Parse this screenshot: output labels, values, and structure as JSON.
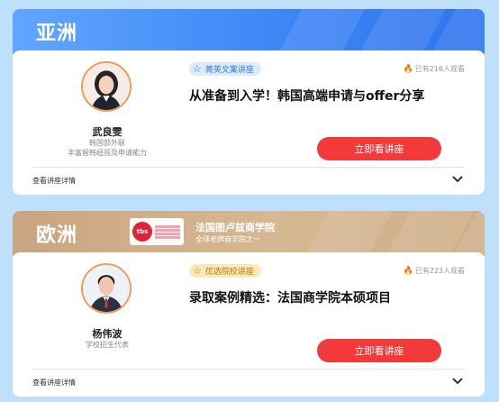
{
  "asia": {
    "region_title": "亚洲",
    "speaker": {
      "name": "武良雯",
      "line1": "韩国部外联",
      "line2": "丰富留韩经验及申请能力"
    },
    "tag": "菁英文案讲座",
    "views": "已有216人观看",
    "title": "从准备到入学！韩国高端申请与offer分享",
    "button": "立即看讲座",
    "details": "查看讲座详情"
  },
  "europe": {
    "region_title": "欧洲",
    "school": {
      "logo_text": "tbs",
      "name": "法国图卢兹商学院",
      "subtitle": "全球老牌商学院之一"
    },
    "speaker": {
      "name": "杨伟波",
      "line1": "学校招生代表"
    },
    "tag": "优选院校讲座",
    "views": "已有223人观看",
    "title": "录取案例精选：法国商学院本硕项目",
    "button": "立即看讲座",
    "details": "查看讲座详情"
  },
  "colors": {
    "accent_blue": "#2f74ee",
    "accent_gold": "#d6b893",
    "button_red": "#f23a3a"
  },
  "icons": [
    "star-icon",
    "fire-icon",
    "chevron-down-icon",
    "avatar"
  ]
}
